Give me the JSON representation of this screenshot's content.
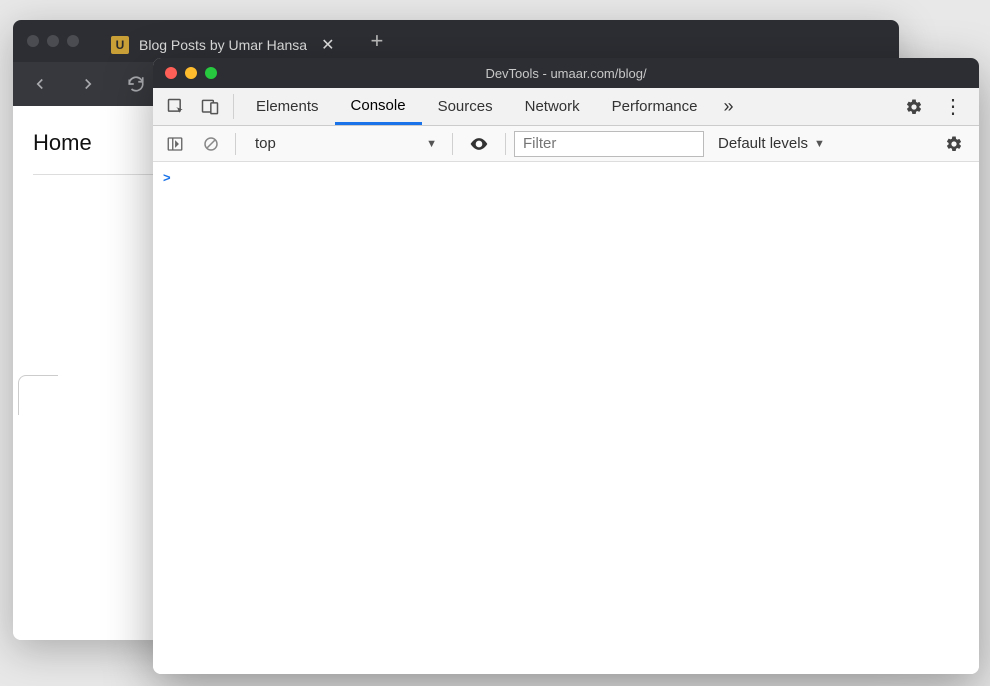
{
  "browser": {
    "tab": {
      "favicon_letter": "U",
      "title": "Blog Posts by Umar Hansa"
    },
    "page": {
      "home_label": "Home"
    }
  },
  "devtools": {
    "title": "DevTools - umaar.com/blog/",
    "tabs": {
      "elements": "Elements",
      "console": "Console",
      "sources": "Sources",
      "network": "Network",
      "performance": "Performance"
    },
    "console": {
      "context": "top",
      "filter_placeholder": "Filter",
      "levels_label": "Default levels",
      "prompt": ">"
    }
  }
}
